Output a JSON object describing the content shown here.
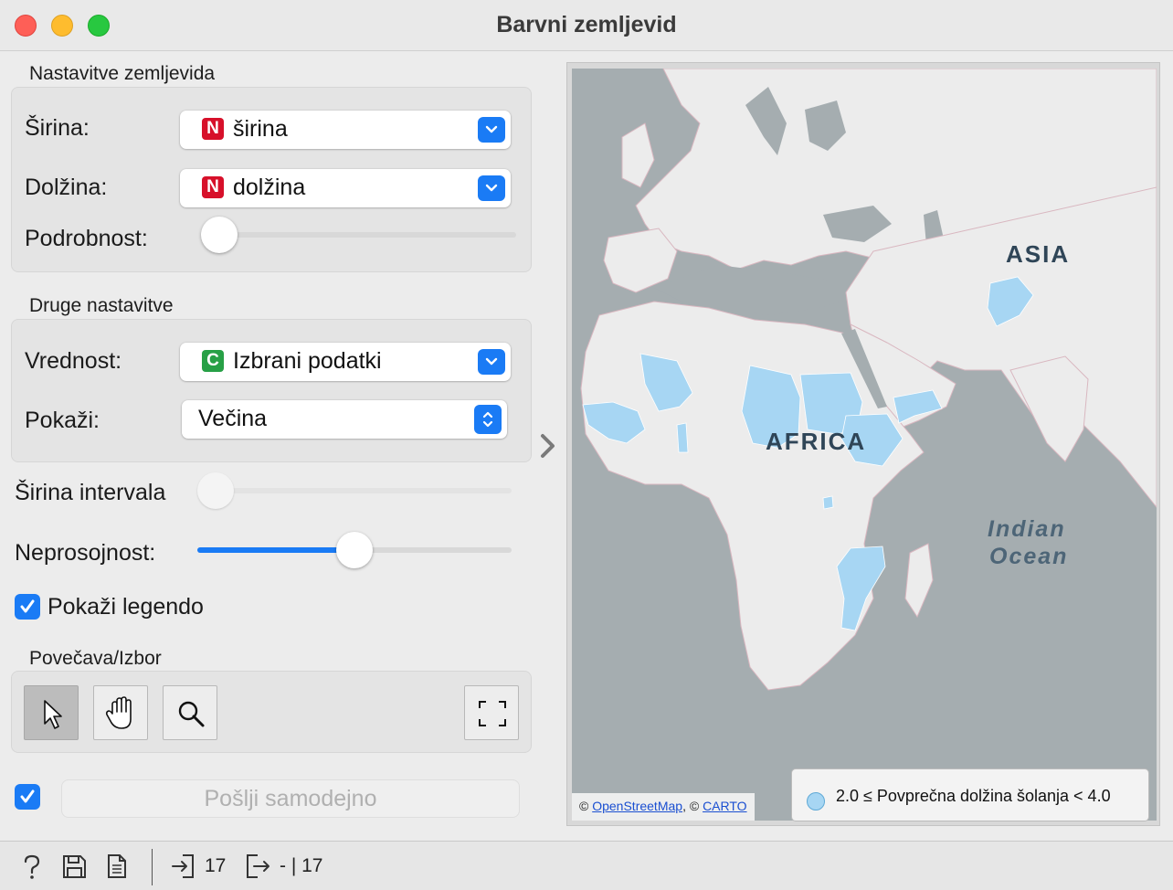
{
  "window": {
    "title": "Barvni zemljevid"
  },
  "map_settings": {
    "section_title": "Nastavitve zemljevida",
    "latitude_label": "Širina:",
    "latitude_value": "širina",
    "latitude_type": "N",
    "longitude_label": "Dolžina:",
    "longitude_value": "dolžina",
    "longitude_type": "N",
    "detail_label": "Podrobnost:",
    "detail_level": 0
  },
  "other_settings": {
    "section_title": "Druge nastavitve",
    "value_label": "Vrednost:",
    "value_value": "Izbrani podatki",
    "value_type": "C",
    "show_label": "Pokaži:",
    "show_value": "Večina"
  },
  "bin_width": {
    "label": "Širina intervala",
    "level": 0
  },
  "opacity": {
    "label": "Neprosojnost:",
    "level": 0.5
  },
  "show_legend": {
    "label": "Pokaži legendo",
    "checked": true
  },
  "zoom_select": {
    "section_title": "Povečava/Izbor",
    "tools": [
      "pointer-icon",
      "hand-icon",
      "zoom-icon",
      "fit-icon"
    ]
  },
  "send": {
    "auto_checked": true,
    "label": "Pošlji samodejno"
  },
  "map": {
    "labels": {
      "asia": "ASIA",
      "africa": "AFRICA",
      "ocean_line1": "Indian",
      "ocean_line2": "Ocean"
    },
    "attribution": {
      "prefix": "©",
      "osm": "OpenStreetMap",
      "separator": ", ©",
      "carto": "CARTO"
    },
    "legend": {
      "text": "2.0 ≤ Povprečna dolžina šolanja < 4.0",
      "color": "#a7d6f3"
    },
    "colors": {
      "water": "#a5adb0",
      "land": "#ececec",
      "border": "#d9b7c0",
      "highlight": "#a7d6f3"
    }
  },
  "status": {
    "input_count": "17",
    "output_count": "- | 17"
  },
  "colors": {
    "accent": "#1a7bf5",
    "numeric_badge": "#d7102a",
    "categorical_badge": "#27a046"
  }
}
